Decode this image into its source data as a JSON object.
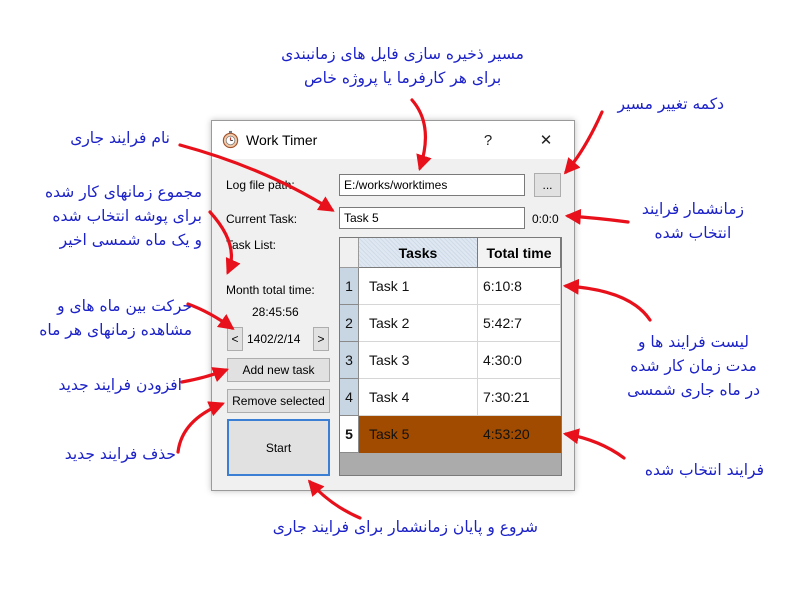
{
  "window": {
    "title": "Work Timer",
    "help_label": "?",
    "close_label": "✕"
  },
  "form": {
    "log_label": "Log file path:",
    "log_value": "E:/works/worktimes",
    "browse_label": "...",
    "current_task_label": "Current Task:",
    "current_task_value": "Task 5",
    "timer_value": "0:0:0",
    "task_list_label": "Task List:",
    "month_total_label": "Month total time:",
    "month_total_value": "28:45:56",
    "prev_month_label": "<",
    "month_value": "1402/2/14",
    "next_month_label": ">",
    "add_task_label": "Add new task",
    "remove_label": "Remove selected",
    "start_label": "Start"
  },
  "grid": {
    "columns": [
      "Tasks",
      "Total time"
    ],
    "rows": [
      {
        "num": "1",
        "task": "Task 1",
        "time": "6:10:8"
      },
      {
        "num": "2",
        "task": "Task 2",
        "time": "5:42:7"
      },
      {
        "num": "3",
        "task": "Task 3",
        "time": "4:30:0"
      },
      {
        "num": "4",
        "task": "Task 4",
        "time": "7:30:21"
      },
      {
        "num": "5",
        "task": "Task 5",
        "time": "4:53:20"
      }
    ],
    "selected_row": 5,
    "selected_color": "#a04b00"
  },
  "annotations": {
    "log_path_line1": "مسیر ذخیره سازی فایل های زمانبندی",
    "log_path_line2": "برای هر کارفرما یا پروژه خاص",
    "change_path": "دکمه تغییر مسیر",
    "current_name": "نام فرایند جاری",
    "month_total_line1": "مجموع زمانهای کار شده",
    "month_total_line2": "برای پوشه انتخاب شده",
    "month_total_line3": "و یک ماه شمسی اخیر",
    "timer_line1": "زمانشمار فرایند",
    "timer_line2": "انتخاب شده",
    "month_nav_line1": "حرکت بین ماه های و",
    "month_nav_line2": "مشاهده زمانهای هر ماه",
    "add_task": "افزودن فرایند جدید",
    "remove_task": "حذف فرایند جدید",
    "list_line1": "لیست فرایند ها و",
    "list_line2": "مدت زمان کار شده",
    "list_line3": "در ماه جاری شمسی",
    "selected_task": "فرایند انتخاب شده",
    "start_stop": "شروع و پایان زمانشمار برای فرایند جاری"
  },
  "colors": {
    "annotation_text": "#1c22c8",
    "arrow": "#e8101a",
    "start_border": "#3b7fd4"
  },
  "icons": {
    "app": "stopwatch-icon",
    "help": "help-icon",
    "close": "close-icon"
  }
}
